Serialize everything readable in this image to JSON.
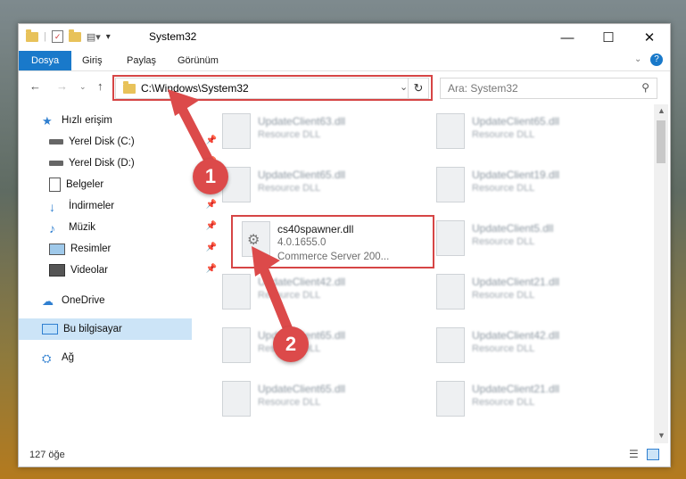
{
  "window": {
    "title": "System32"
  },
  "ribbon": {
    "tabs": [
      "Dosya",
      "Giriş",
      "Paylaş",
      "Görünüm"
    ]
  },
  "address": {
    "path": "C:\\Windows\\System32"
  },
  "search": {
    "placeholder": "Ara: System32"
  },
  "nav": {
    "items": [
      {
        "label": "Hızlı erişim",
        "icon": "star-icon"
      },
      {
        "label": "Yerel Disk (C:)",
        "icon": "drive-icon"
      },
      {
        "label": "Yerel Disk (D:)",
        "icon": "drive-icon"
      },
      {
        "label": "Belgeler",
        "icon": "document-icon"
      },
      {
        "label": "İndirmeler",
        "icon": "download-icon"
      },
      {
        "label": "Müzik",
        "icon": "music-icon"
      },
      {
        "label": "Resimler",
        "icon": "picture-icon"
      },
      {
        "label": "Videolar",
        "icon": "video-icon"
      },
      {
        "label": "OneDrive",
        "icon": "cloud-icon"
      },
      {
        "label": "Bu bilgisayar",
        "icon": "computer-icon"
      },
      {
        "label": "Ağ",
        "icon": "network-icon"
      }
    ]
  },
  "files": [
    {
      "name": "UpdateClient63.dll",
      "desc": "Resource DLL"
    },
    {
      "name": "UpdateClient65.dll",
      "desc": "Resource DLL"
    },
    {
      "name": "UpdateClient65.dll",
      "desc": "Resource DLL"
    },
    {
      "name": "UpdateClient19.dll",
      "desc": "Resource DLL"
    },
    {
      "name": "UpdateClient5.dll",
      "desc": "Resource DLL"
    },
    {
      "name": "UpdateClient42.dll",
      "desc": "Resource DLL"
    },
    {
      "name": "UpdateClient21.dll",
      "desc": "Resource DLL"
    },
    {
      "name": "UpdateClient65.dll",
      "desc": "Resource DLL"
    },
    {
      "name": "UpdateClient42.dll",
      "desc": "Resource DLL"
    },
    {
      "name": "UpdateClient65.dll",
      "desc": "Resource DLL"
    },
    {
      "name": "UpdateClient21.dll",
      "desc": "Resource DLL"
    }
  ],
  "highlighted_file": {
    "name": "cs40spawner.dll",
    "version": "4.0.1655.0",
    "desc": "Commerce Server 200..."
  },
  "status": {
    "count": "127 öğe"
  },
  "annotations": {
    "step1": "1",
    "step2": "2"
  },
  "colors": {
    "accent": "#1979ca",
    "highlight": "#d64545",
    "badge": "#dc4a4a"
  }
}
